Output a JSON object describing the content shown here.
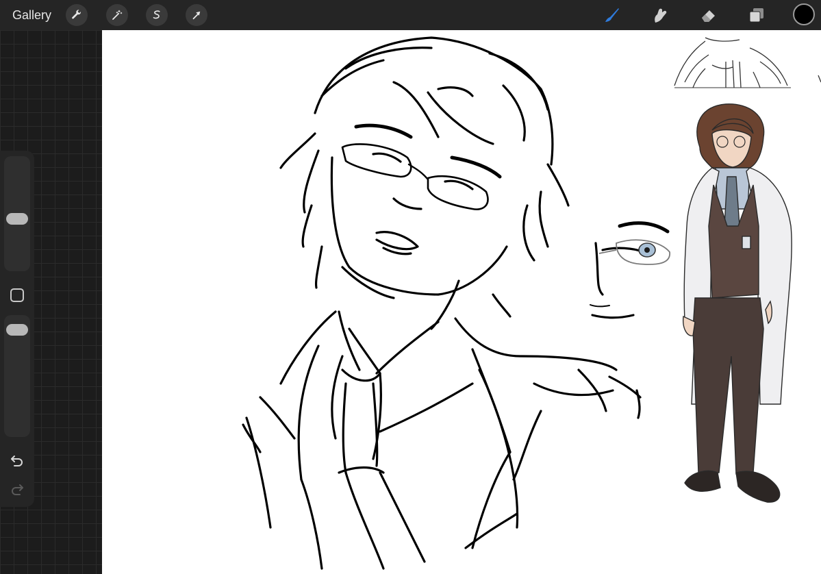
{
  "app": {
    "gallery_label": "Gallery"
  },
  "toolbar": {
    "left_icons": [
      "wrench-icon",
      "magic-wand-icon",
      "selection-icon",
      "transform-arrow-icon"
    ],
    "right_icons": [
      "brush-icon",
      "smudge-icon",
      "eraser-icon",
      "layers-icon"
    ],
    "active_tool": "brush",
    "active_tool_color": "#2f7bdc",
    "current_color": "#000000"
  },
  "sidebar": {
    "controls": [
      "brush-size-slider",
      "modify-button",
      "opacity-slider",
      "undo-icon",
      "redo-icon"
    ]
  },
  "canvas": {
    "background": "#ffffff",
    "ink_color": "#000000"
  }
}
